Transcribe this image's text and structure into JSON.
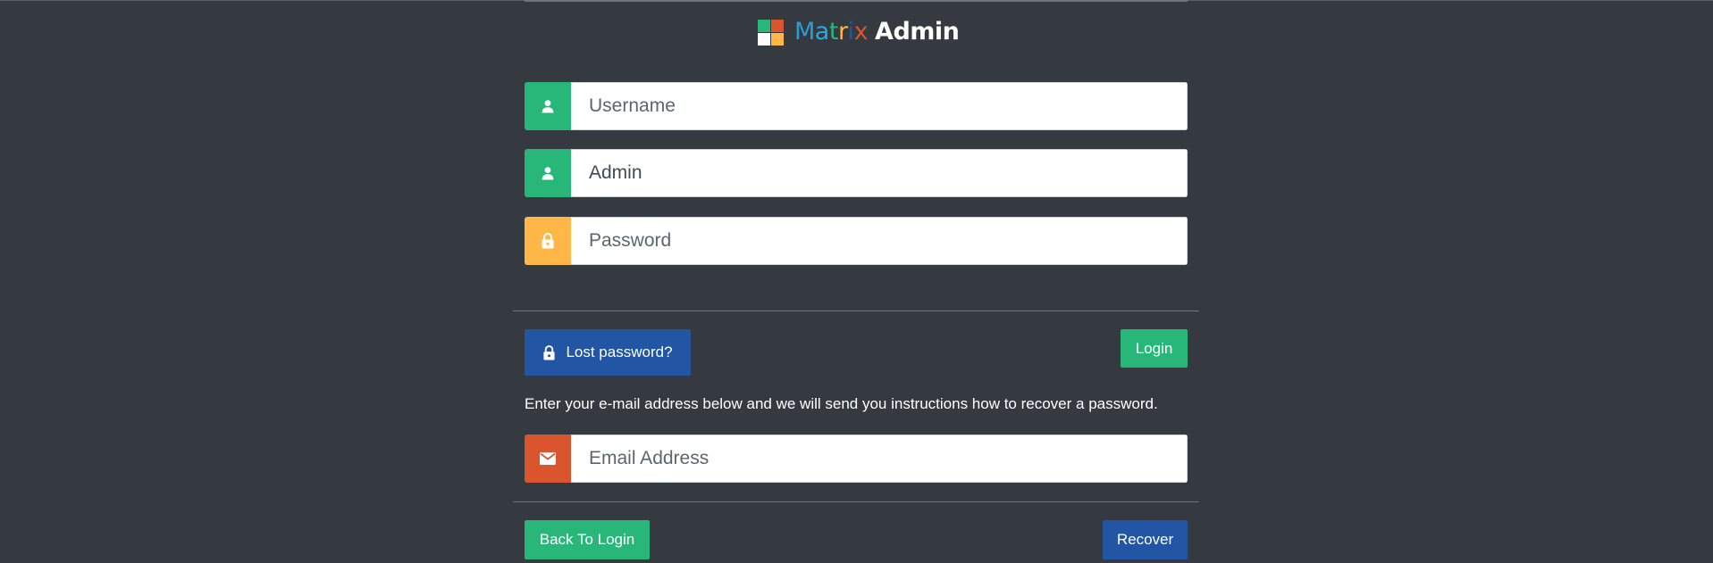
{
  "logo": {
    "letters": [
      "M",
      "a",
      "t",
      "r",
      "i",
      "x"
    ],
    "strong": "Admin",
    "tile_colors": [
      "#28b779",
      "#da542e",
      "#ffffff",
      "#ffb848"
    ],
    "icon": "matrix-logo-mark"
  },
  "login_form": {
    "username": {
      "placeholder": "Username",
      "icon": "user-icon",
      "addon_color": "#28b779"
    },
    "role": {
      "value": "Admin",
      "icon": "user-icon",
      "addon_color": "#28b779"
    },
    "password": {
      "placeholder": "Password",
      "icon": "lock-icon",
      "addon_color": "#ffb848"
    },
    "lost_password_label": "Lost password?",
    "login_label": "Login"
  },
  "recover_form": {
    "help_text": "Enter your e-mail address below and we will send you instructions how to recover a password.",
    "email": {
      "placeholder": "Email Address",
      "icon": "envelope-icon",
      "addon_color": "#da542e"
    },
    "back_label": "Back To Login",
    "recover_label": "Recover"
  },
  "colors": {
    "background": "#343a40",
    "success": "#28b779",
    "primary": "#2255a4",
    "warning": "#ffb848",
    "danger": "#da542e"
  }
}
